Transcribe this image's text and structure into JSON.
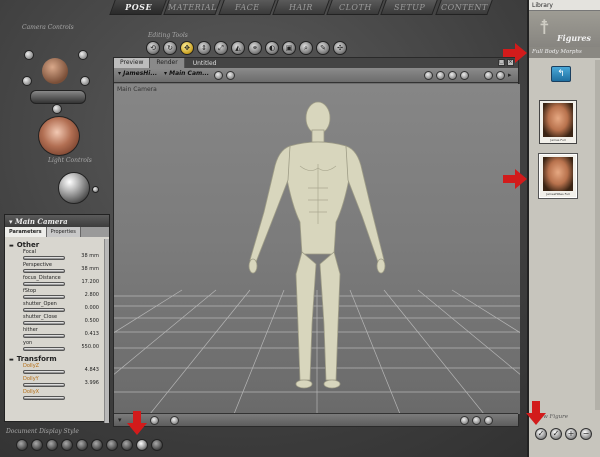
{
  "tabs": [
    "POSE",
    "MATERIAL",
    "FACE",
    "HAIR",
    "CLOTH",
    "SETUP",
    "CONTENT"
  ],
  "active_tab": "POSE",
  "camera_controls_label": "Camera Controls",
  "light_controls_label": "Light Controls",
  "editing_tools_label": "Editing Tools",
  "document": {
    "tabs": [
      "Preview",
      "Render"
    ],
    "title": "Untitled",
    "figure_select": "▾ JamesHi...",
    "camera_select": "▾ Main Cam...",
    "viewport_label": "Main Camera"
  },
  "parameters": {
    "title": "▾ Main Camera",
    "tabs": [
      "Parameters",
      "Properties"
    ],
    "groups": [
      {
        "title": "Other",
        "items": [
          {
            "name": "Focal",
            "value": "38 mm",
            "orange": false
          },
          {
            "name": "Perspective",
            "value": "38 mm",
            "orange": false
          },
          {
            "name": "focus_Distance",
            "value": "17.200",
            "orange": false
          },
          {
            "name": "fStop",
            "value": "2.800",
            "orange": false
          },
          {
            "name": "shutter_Open",
            "value": "0.000",
            "orange": false
          },
          {
            "name": "shutter_Close",
            "value": "0.500",
            "orange": false
          },
          {
            "name": "hither",
            "value": "0.413",
            "orange": false
          },
          {
            "name": "yon",
            "value": "550.00",
            "orange": false
          }
        ]
      },
      {
        "title": "Transform",
        "items": [
          {
            "name": "DollyZ",
            "value": "4.843",
            "orange": true
          },
          {
            "name": "DollyY",
            "value": "3.996",
            "orange": true
          },
          {
            "name": "DollyX",
            "value": "",
            "orange": true
          }
        ]
      }
    ]
  },
  "document_display_label": "Document Display Style",
  "library": {
    "title": "Library",
    "category": "Figures",
    "subcategory": "Full Body Morphs",
    "hint": "New Figure",
    "thumbs": [
      {
        "name": "James Full",
        "selected": false
      },
      {
        "name": "JamesHiRes Full",
        "selected": true
      }
    ]
  },
  "colors": {
    "accent_arrow": "#d21b1b"
  }
}
